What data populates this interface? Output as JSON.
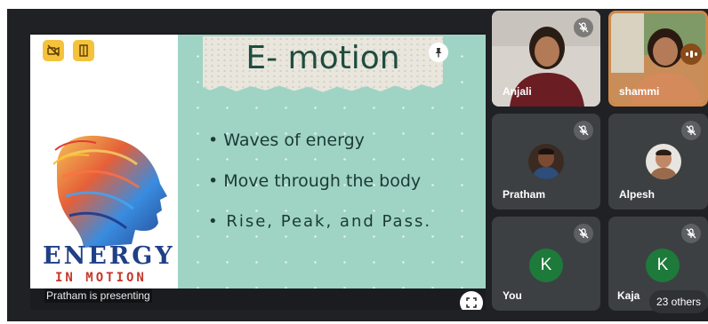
{
  "presentation": {
    "presenter_label": "Pratham is presenting",
    "slide": {
      "title": "E- motion",
      "bullets": [
        "• Waves of energy",
        "• Move through the body",
        "• Rise, Peak, and Pass."
      ],
      "logo_lines": [
        "ENERGY",
        "IN MOTION"
      ]
    }
  },
  "participants": [
    {
      "name": "Anjali",
      "muted": true
    },
    {
      "name": "shammi",
      "speaking": true
    },
    {
      "name": "Pratham",
      "muted": true
    },
    {
      "name": "Alpesh",
      "muted": true
    },
    {
      "name": "You",
      "muted": true,
      "avatar_letter": "K",
      "avatar_color": "#1e7a3a"
    },
    {
      "name": "Kaja",
      "muted": true,
      "avatar_letter": "K",
      "avatar_color": "#1e7a3a"
    }
  ],
  "others_chip": "23 others",
  "colors": {
    "stage_bg": "#202124",
    "tile_bg": "#3c4043",
    "slide_teal": "#9fd4c4",
    "badge_yellow": "#f4c23c",
    "speaking_ring": "#d08a4a"
  },
  "icons": {
    "badge_1": "camera-off-icon",
    "badge_2": "door-icon",
    "pin": "pin-icon",
    "fullscreen": "fullscreen-icon",
    "mute": "mic-off-icon",
    "speaking": "audio-level-icon"
  }
}
